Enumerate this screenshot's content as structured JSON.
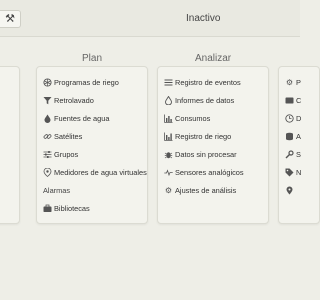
{
  "topbar": {
    "tools_icon": "tools-icon",
    "status": "Inactivo"
  },
  "columns": {
    "plan": {
      "title": "Plan",
      "items": [
        {
          "label": "Programas de riego",
          "icon": "sprinkler-icon"
        },
        {
          "label": "Retrolavado",
          "icon": "filter-icon"
        },
        {
          "label": "Fuentes de agua",
          "icon": "water-drop-icon"
        },
        {
          "label": "Satélites",
          "icon": "link-icon"
        },
        {
          "label": "Grupos",
          "icon": "sliders-icon"
        },
        {
          "label": "Medidores de agua virtuales",
          "icon": "meter-icon"
        },
        {
          "label": "Alarmas",
          "icon": ""
        },
        {
          "label": "Bibliotecas",
          "icon": "briefcase-icon"
        }
      ]
    },
    "analizar": {
      "title": "Analizar",
      "items": [
        {
          "label": "Registro de eventos",
          "icon": "list-icon"
        },
        {
          "label": "Informes de datos",
          "icon": "water-drop-icon"
        },
        {
          "label": "Consumos",
          "icon": "bar-chart-icon"
        },
        {
          "label": "Registro de riego",
          "icon": "bar-chart-icon"
        },
        {
          "label": "Datos sin procesar",
          "icon": "bug-icon"
        },
        {
          "label": "Sensores analógicos",
          "icon": "pulse-icon"
        },
        {
          "label": "Ajustes de análisis",
          "icon": "gear-icon"
        }
      ]
    },
    "right": {
      "items": [
        {
          "label": "P",
          "icon": "gear-icon"
        },
        {
          "label": "C",
          "icon": "card-icon"
        },
        {
          "label": "D",
          "icon": "clock-icon"
        },
        {
          "label": "A",
          "icon": "database-icon"
        },
        {
          "label": "S",
          "icon": "wrench-icon"
        },
        {
          "label": "N",
          "icon": "tag-icon"
        },
        {
          "label": "",
          "icon": "map-marker-icon"
        }
      ]
    }
  }
}
